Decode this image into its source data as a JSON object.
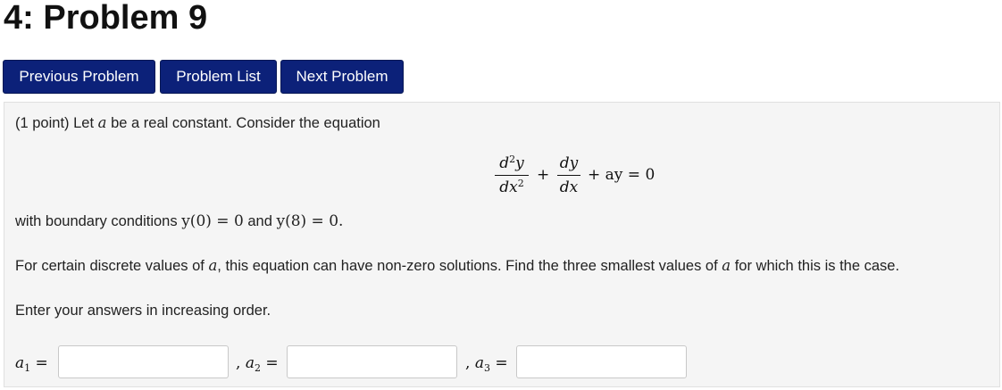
{
  "page": {
    "title": "4: Problem 9"
  },
  "nav": {
    "previous_label": "Previous Problem",
    "list_label": "Problem List",
    "next_label": "Next Problem"
  },
  "colors": {
    "nav_button_bg": "#0c2179",
    "nav_button_text": "#ffffff",
    "problem_box_bg": "#f5f5f5"
  },
  "problem": {
    "intro_prefix": "(1 point) Let ",
    "intro_var": "a",
    "intro_suffix": " be a real constant. Consider the equation",
    "equation": {
      "frac1_num": "d",
      "frac1_num_exp": "2",
      "frac1_num_var": "y",
      "frac1_den": "dx",
      "frac1_den_exp": "2",
      "plus1": "+",
      "frac2_num": "dy",
      "frac2_den": "dx",
      "rest": "+ ay = 0"
    },
    "boundary_prefix": "with boundary conditions ",
    "boundary_cond1": "y(0) = 0",
    "boundary_and": " and ",
    "boundary_cond2": "y(8) = 0.",
    "question_prefix": "For certain discrete values of ",
    "question_var1": "a",
    "question_middle": ", this equation can have non-zero solutions. Find the three smallest values of ",
    "question_var2": "a",
    "question_suffix": " for which this is the case.",
    "instruction": "Enter your answers in increasing order."
  },
  "answers": [
    {
      "var": "a",
      "sub": "1",
      "eq": "=",
      "sep": "",
      "value": ""
    },
    {
      "var": "a",
      "sub": "2",
      "eq": "=",
      "sep": ",",
      "value": ""
    },
    {
      "var": "a",
      "sub": "3",
      "eq": "=",
      "sep": ",",
      "value": ""
    }
  ]
}
